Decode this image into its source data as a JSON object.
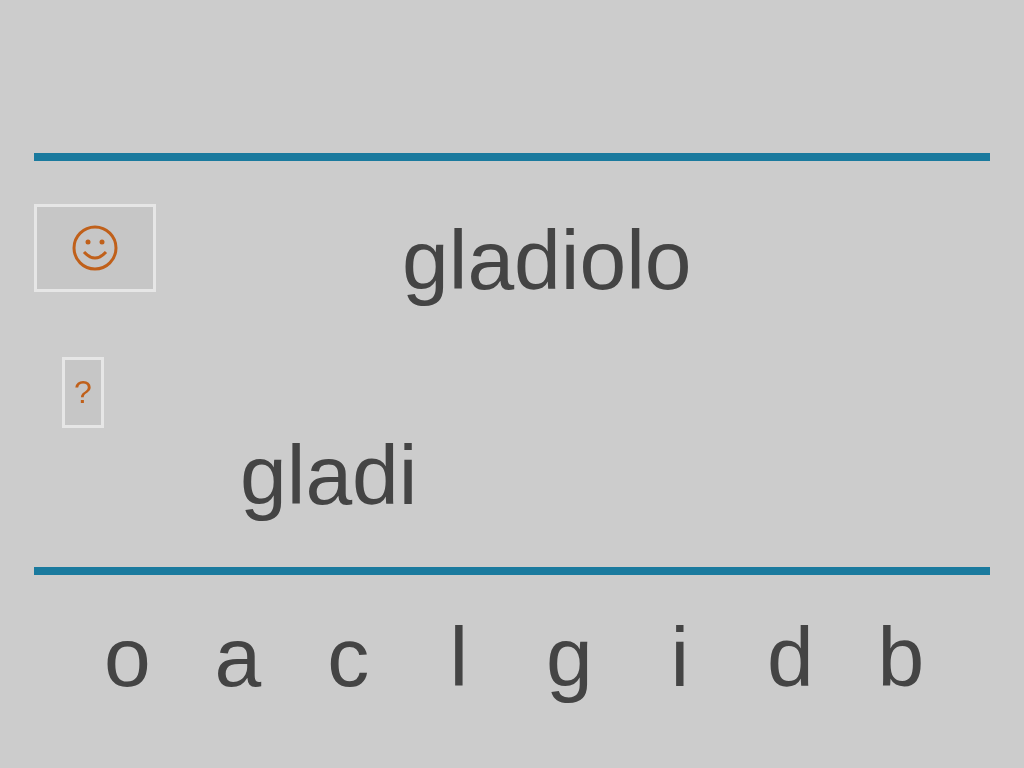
{
  "word": "gladiolo",
  "hint_button": {
    "label": "?"
  },
  "answer": "gladi",
  "letters": [
    "o",
    "a",
    "c",
    "l",
    "g",
    "i",
    "d",
    "b"
  ]
}
